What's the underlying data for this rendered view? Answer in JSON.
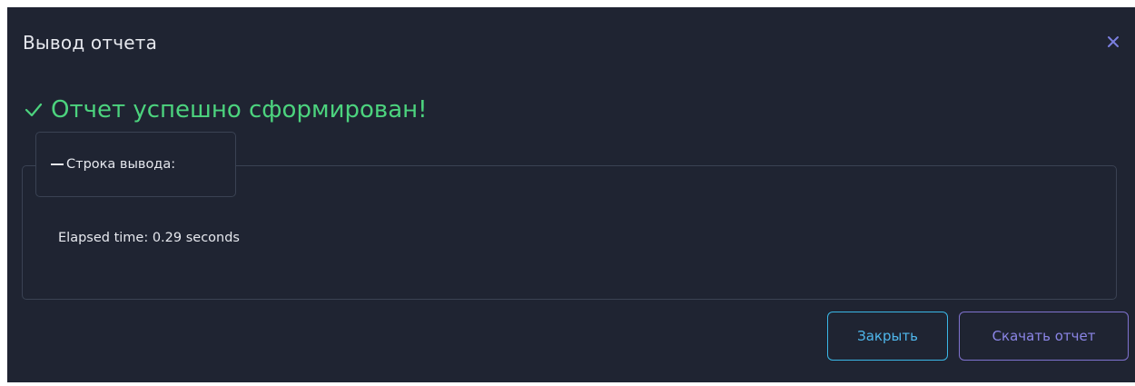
{
  "dialog": {
    "title": "Вывод отчета",
    "close_icon": "close-icon",
    "success_message": "Отчет успешно сформирован!",
    "success_icon": "checkmark-icon",
    "output_legend": "Строка вывода:",
    "output_text": "Elapsed time: 0.29 seconds",
    "buttons": {
      "close_label": "Закрыть",
      "download_label": "Скачать отчет"
    }
  },
  "colors": {
    "background": "#1f2432",
    "text": "#e6e8ee",
    "success": "#4cd37e",
    "close_icon": "#7b7fe0",
    "close_button": "#3ab7e6",
    "download_button": "#7f72cf",
    "border": "#3a4253"
  }
}
